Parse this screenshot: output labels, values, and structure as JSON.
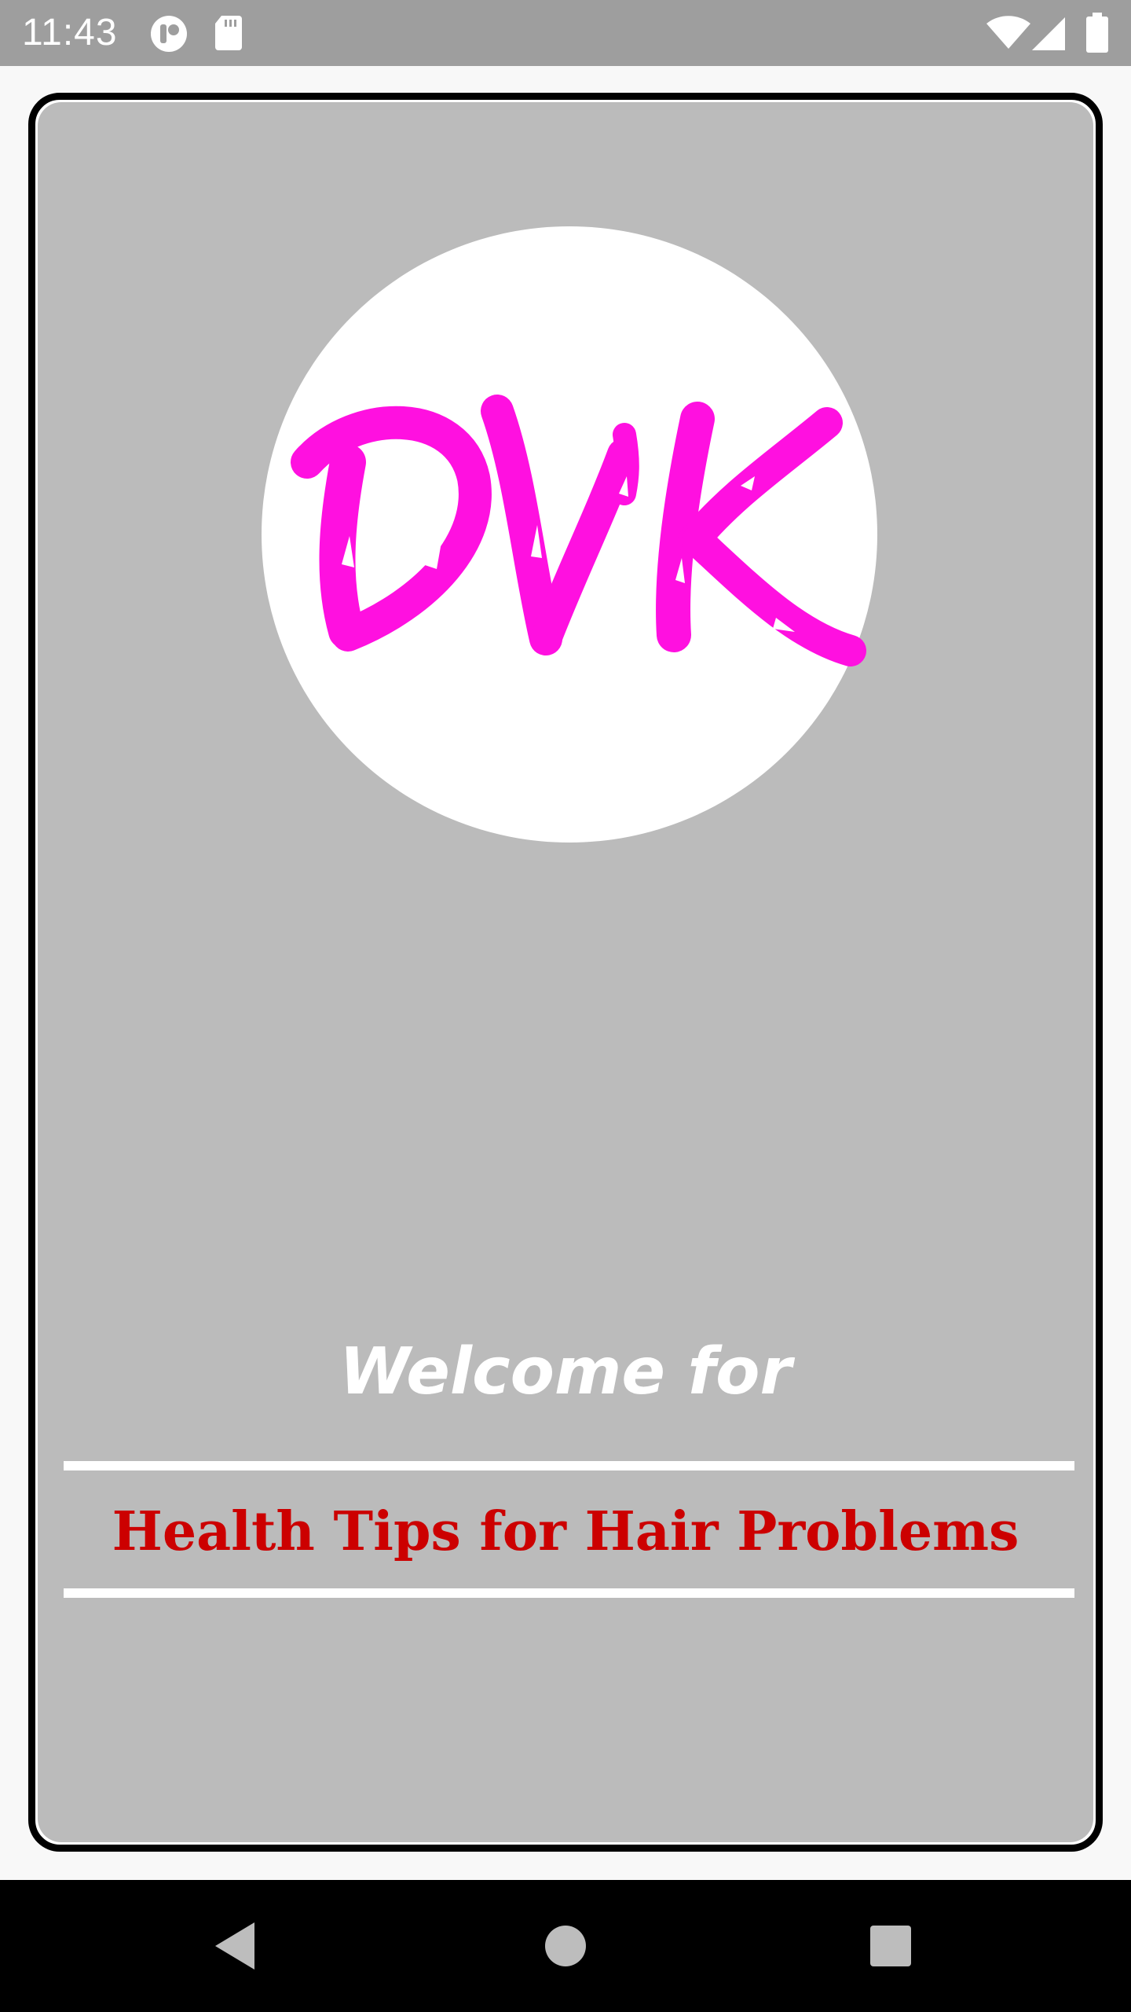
{
  "status_bar": {
    "time": "11:43",
    "icons": [
      "app-notification-icon",
      "sd-card-icon",
      "wifi-icon",
      "cellular-signal-icon",
      "battery-icon"
    ]
  },
  "card": {
    "logo": {
      "text": "DVK",
      "color": "#ff10e0",
      "background": "#ffffff"
    },
    "welcome_text": "Welcome for",
    "subtitle_text": "Health Tips for Hair Problems",
    "colors": {
      "card_background": "#bbbbbb",
      "border": "#000000",
      "subtitle": "#cc0000",
      "welcome": "#ffffff"
    }
  },
  "nav_bar": {
    "buttons": [
      "back-icon",
      "home-icon",
      "recents-icon"
    ]
  }
}
